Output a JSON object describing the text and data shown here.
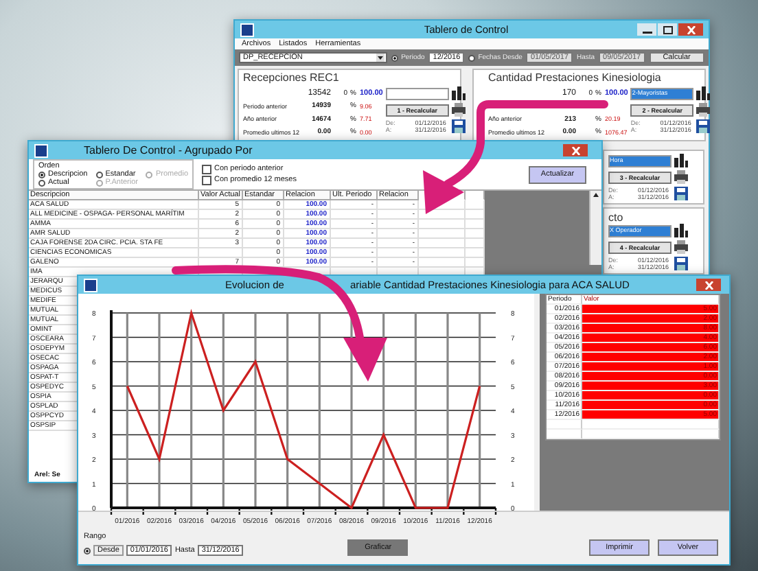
{
  "control_panel": {
    "title": "Tablero de Control",
    "menu": [
      "Archivos",
      "Listados",
      "Herramientas"
    ],
    "toolbar": {
      "selector": "DP_RECEPCION",
      "modes": [
        {
          "label": "Periodo",
          "selected": true,
          "value": "12/2016"
        },
        {
          "label": "Fechas Desde",
          "selected": false,
          "value": "01/05/2017"
        }
      ],
      "to_label": "Hasta",
      "date_to": "09/05/2017",
      "calculate": "Calcular"
    },
    "panels": [
      {
        "title": "Recepciones REC1",
        "current": "13542",
        "delta": "0",
        "unit": "%",
        "ratio": "100.00",
        "rows": [
          {
            "kind": "value",
            "label": "Periodo anterior",
            "value": "14939",
            "unit": "%",
            "ratio": "9.06"
          },
          {
            "kind": "value",
            "label": "Año anterior",
            "value": "14674",
            "unit": "%",
            "ratio": "7.71"
          },
          {
            "kind": "value",
            "label": "Promedio ultimos 12",
            "value": "0.00",
            "unit": "%",
            "ratio": "0.00"
          }
        ],
        "button": "1 - Recalcular",
        "from_label": "De:",
        "from": "01/12/2016",
        "to_label": "A:",
        "to": "31/12/2016"
      },
      {
        "title": "Cantidad Prestaciones Kinesiologia",
        "current": "170",
        "delta": "0",
        "unit": "%",
        "ratio": "100.00",
        "selector": "2-Mayoristas",
        "rows": [
          {
            "kind": "covered"
          },
          {
            "kind": "value",
            "label": "Año anterior",
            "value": "213",
            "unit": "%",
            "ratio": "20.19"
          },
          {
            "kind": "value",
            "label": "Promedio ultimos 12",
            "value": "0.00",
            "unit": "%",
            "ratio": "1076.47"
          }
        ],
        "button": "2 - Recalcular",
        "from_label": "De:",
        "from": "01/12/2016",
        "to_label": "A:",
        "to": "31/12/2016"
      }
    ],
    "side_panels": [
      {
        "selector": "Hora",
        "button": "3 - Recalcular",
        "from_label": "De:",
        "from": "01/12/2016",
        "to_label": "A:",
        "to": "31/12/2016"
      },
      {
        "title": "cto",
        "selector": "X Operador",
        "button": "4 - Recalcular",
        "from_label": "De:",
        "from": "01/12/2016",
        "to_label": "A:",
        "to": "31/12/2016"
      }
    ]
  },
  "grouped": {
    "title": "Tablero De Control - Agrupado Por",
    "order_label": "Orden",
    "order": [
      {
        "label": "Descripcion",
        "selected": true,
        "disabled": false
      },
      {
        "label": "Estandar",
        "selected": false,
        "disabled": false
      },
      {
        "label": "Promedio",
        "selected": false,
        "disabled": true
      },
      {
        "label": "Actual",
        "selected": false,
        "disabled": false
      },
      {
        "label": "P.Anterior",
        "selected": false,
        "disabled": true
      }
    ],
    "options": [
      {
        "label": "Con periodo anterior",
        "checked": false
      },
      {
        "label": "Con promedio 12 meses",
        "checked": false
      }
    ],
    "refresh": "Actualizar",
    "columns": [
      "Descripcion",
      "Valor Actual",
      "Estandar",
      "Relacion",
      "Ult. Periodo",
      "Relacion"
    ],
    "rows": [
      {
        "cells": [
          "ACA SALUD",
          "5",
          "0",
          "100.00",
          "-",
          "-"
        ]
      },
      {
        "cells": [
          "ALL MEDICINE - OSPAGA- PERSONAL MARÍTIM",
          "2",
          "0",
          "100.00",
          "-",
          "-"
        ]
      },
      {
        "cells": [
          "AMMA",
          "6",
          "0",
          "100.00",
          "-",
          "-"
        ]
      },
      {
        "cells": [
          "AMR SALUD",
          "2",
          "0",
          "100.00",
          "-",
          "-"
        ]
      },
      {
        "cells": [
          "CAJA FORENSE 2DA CIRC. PCIA. STA FE",
          "3",
          "0",
          "100.00",
          "-",
          "-"
        ]
      },
      {
        "cells": [
          "CIENCIAS ECONOMICAS",
          null,
          "0",
          "100.00",
          "-",
          "-"
        ]
      },
      {
        "cells": [
          "GALENO",
          "7",
          "0",
          "100.00",
          "-",
          "-"
        ]
      },
      {
        "cells": [
          "IMA"
        ]
      },
      {
        "cells": [
          "JERARQU"
        ]
      },
      {
        "cells": [
          "MEDICUS"
        ]
      },
      {
        "cells": [
          "MEDIFE"
        ]
      },
      {
        "cells": [
          "MUTUAL"
        ]
      },
      {
        "cells": [
          "MUTUAL"
        ]
      },
      {
        "cells": [
          "OMINT"
        ]
      },
      {
        "cells": [
          "OSCEARA"
        ]
      },
      {
        "cells": [
          "OSDEPYM"
        ]
      },
      {
        "cells": [
          "OSECAC"
        ]
      },
      {
        "cells": [
          "OSPAGA"
        ]
      },
      {
        "cells": [
          "OSPAT-T"
        ]
      },
      {
        "cells": [
          "OSPEDYC"
        ]
      },
      {
        "cells": [
          "OSPIA"
        ]
      },
      {
        "cells": [
          "OSPLAD"
        ]
      },
      {
        "cells": [
          "OSPPCYD"
        ]
      },
      {
        "cells": [
          "OSPSIP"
        ]
      }
    ],
    "footer": "Arel: Se"
  },
  "chart_window": {
    "title_parts": [
      "Evolucion de",
      "ariable Cantidad Prestaciones Kinesiologia para ACA SALUD"
    ],
    "chart_data": {
      "type": "line",
      "categories": [
        "01/2016",
        "02/2016",
        "03/2016",
        "04/2016",
        "05/2016",
        "06/2016",
        "07/2016",
        "08/2016",
        "09/2016",
        "10/2016",
        "11/2016",
        "12/2016"
      ],
      "series": [
        {
          "color": "#cc2020",
          "values": [
            5,
            2,
            8,
            4,
            6,
            2,
            1,
            0,
            3,
            0,
            0,
            5
          ]
        }
      ],
      "ylim": [
        0,
        8
      ],
      "yticks": [
        0,
        1,
        2,
        3,
        4,
        5,
        6,
        7,
        8
      ],
      "grid": true
    },
    "left_axis_labels": [
      "8",
      "7",
      "6",
      "5",
      "4",
      "3",
      "2",
      "1",
      "0"
    ],
    "right_axis_labels": [
      "8",
      "7",
      "6",
      "5",
      "4",
      "3",
      "2",
      "1",
      "0"
    ],
    "table": {
      "columns": [
        "Periodo",
        "Valor"
      ],
      "rows": [
        {
          "period": "01/2016",
          "value": "5.00"
        },
        {
          "period": "02/2016",
          "value": "2.00"
        },
        {
          "period": "03/2016",
          "value": "8.00"
        },
        {
          "period": "04/2016",
          "value": "4.00"
        },
        {
          "period": "05/2016",
          "value": "6.00"
        },
        {
          "period": "06/2016",
          "value": "2.00"
        },
        {
          "period": "07/2016",
          "value": "1.00"
        },
        {
          "period": "08/2016",
          "value": "0.00"
        },
        {
          "period": "09/2016",
          "value": "3.00"
        },
        {
          "period": "10/2016",
          "value": "0.00"
        },
        {
          "period": "11/2016",
          "value": "0.00"
        },
        {
          "period": "12/2016",
          "value": "5.00"
        }
      ]
    },
    "range": {
      "label": "Rango",
      "from_selected": true,
      "from_label": "Desde",
      "from": "01/01/2016",
      "to_label": "Hasta",
      "to": "31/12/2016"
    },
    "plot_button": "Graficar",
    "print_button": "Imprimir",
    "back_button": "Volver"
  }
}
